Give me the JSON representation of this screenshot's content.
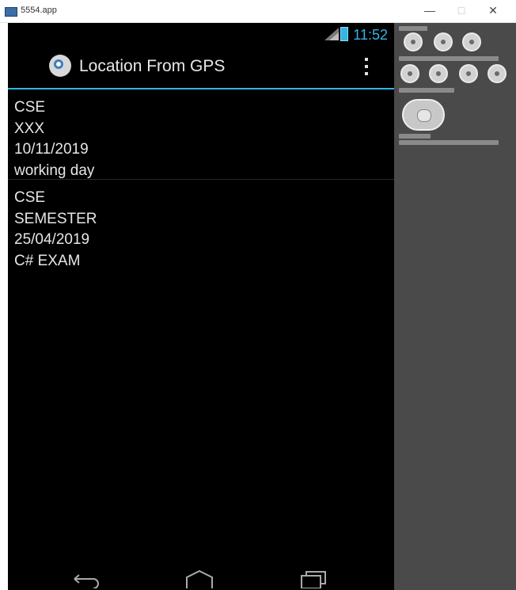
{
  "window": {
    "title": "5554.app",
    "minimize_label": "—",
    "maximize_label": "□",
    "close_label": "✕"
  },
  "status_bar": {
    "time": "11:52",
    "time_color": "#33b5e5"
  },
  "action_bar": {
    "title": "Location From GPS",
    "app_icon": "app-icon",
    "overflow_icon": "overflow-menu-icon"
  },
  "list": {
    "items": [
      {
        "line1": "CSE",
        "line2": "XXX",
        "line3": "10/11/2019",
        "line4": "working day"
      },
      {
        "line1": "CSE",
        "line2": "SEMESTER",
        "line3": "25/04/2019",
        "line4": "C# EXAM"
      }
    ]
  },
  "nav_bar": {
    "back_icon": "back-icon",
    "home_icon": "home-icon",
    "recents_icon": "recents-icon"
  },
  "colors": {
    "accent": "#33b5e5",
    "background": "#000000",
    "side_panel": "#4a4a4a"
  }
}
